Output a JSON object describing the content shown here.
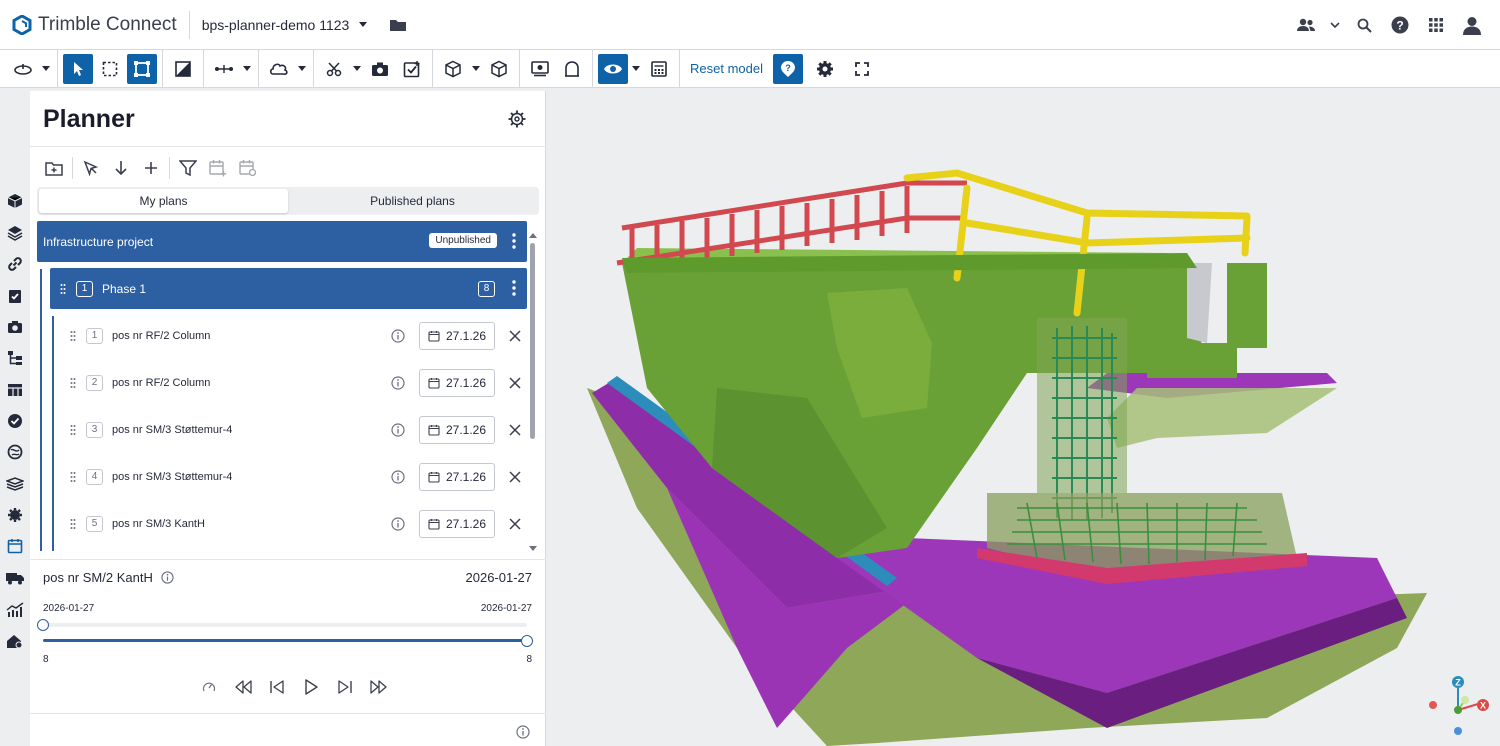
{
  "app": {
    "name": "Trimble Connect",
    "project": "bps-planner-demo 1123"
  },
  "toolbar": {
    "reset_label": "Reset model"
  },
  "planner": {
    "title": "Planner",
    "tabs": [
      "My plans",
      "Published plans"
    ],
    "plan": {
      "name": "Infrastructure project",
      "status": "Unpublished"
    },
    "phase": {
      "index": "1",
      "name": "Phase 1",
      "count": "8"
    },
    "items": [
      {
        "index": "1",
        "name": "pos nr RF/2 Column",
        "date": "27.1.26"
      },
      {
        "index": "2",
        "name": "pos nr RF/2 Column",
        "date": "27.1.26"
      },
      {
        "index": "3",
        "name": "pos nr SM/3 Støttemur-4",
        "date": "27.1.26"
      },
      {
        "index": "4",
        "name": "pos nr SM/3 Støttemur-4",
        "date": "27.1.26"
      },
      {
        "index": "5",
        "name": "pos nr SM/3 KantH",
        "date": "27.1.26"
      }
    ],
    "selection": {
      "name": "pos nr SM/2 KantH",
      "date": "2026-01-27",
      "range_start": "2026-01-27",
      "range_end": "2026-01-27",
      "min_count": "8",
      "max_count": "8"
    }
  },
  "axes": {
    "z": "Z",
    "x": "X"
  },
  "colors": {
    "primary": "#2d5fa3",
    "accent": "#0e63a8",
    "concrete": "#7fb03a",
    "purple": "#9a2fb2",
    "rebar": "#2a8a55",
    "railing_red": "#d2484f",
    "railing_yellow": "#e7d219"
  }
}
